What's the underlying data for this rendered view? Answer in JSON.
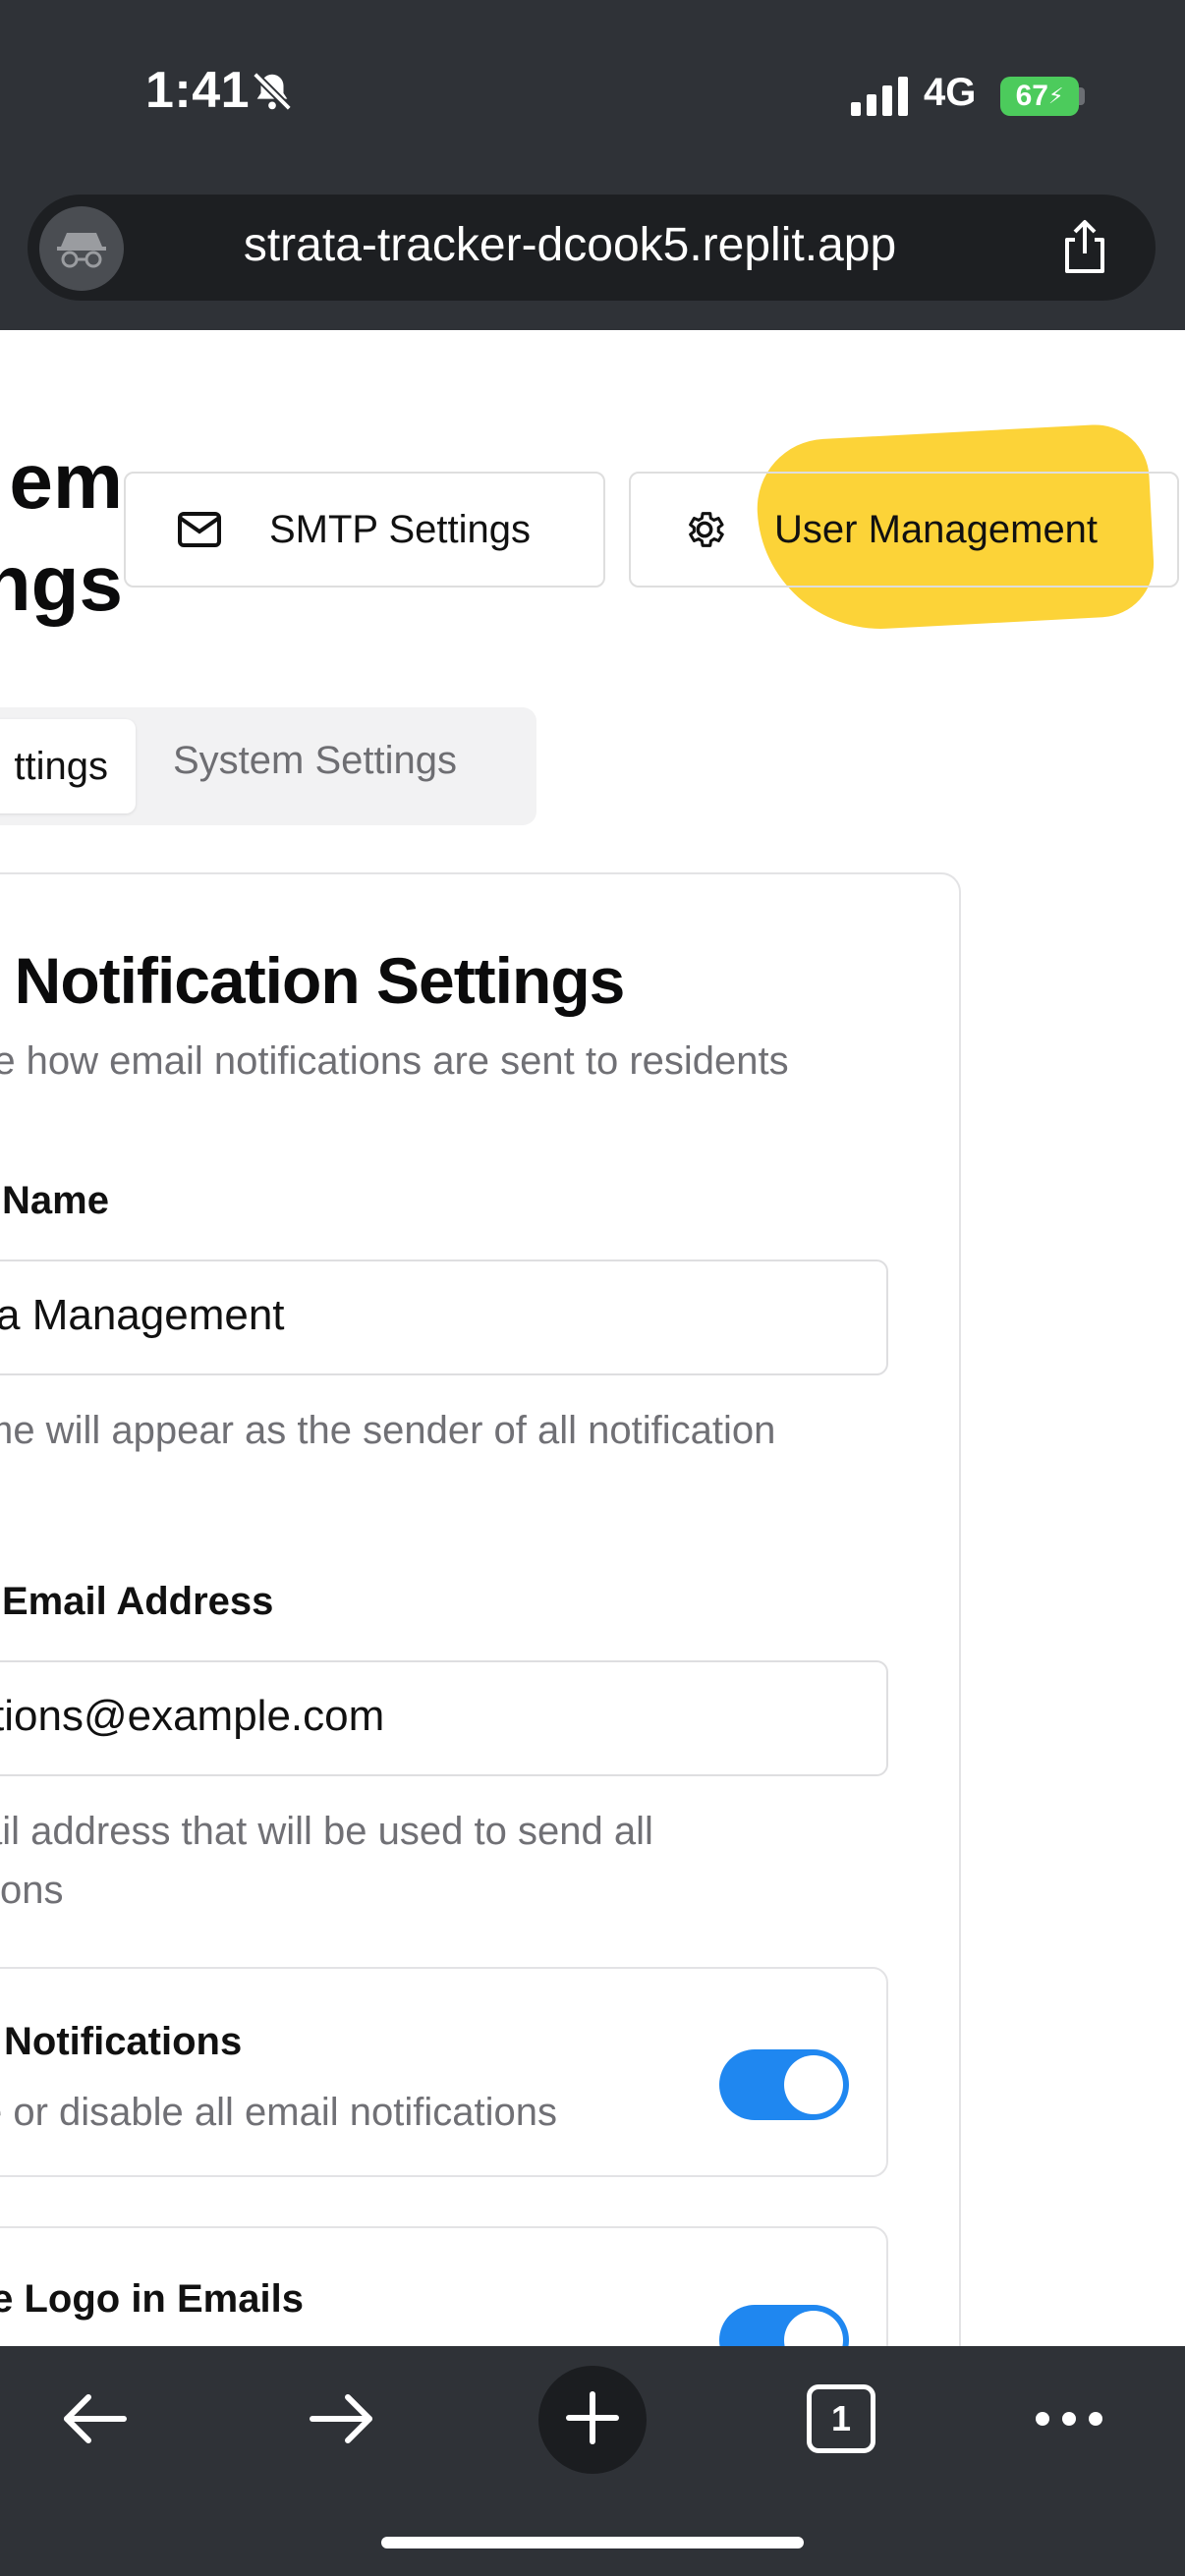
{
  "status_bar": {
    "time": "1:41",
    "network": "4G",
    "battery": "67"
  },
  "browser": {
    "url": "strata-tracker-dcook5.replit.app",
    "tab_count": "1"
  },
  "page": {
    "title_line1": "em",
    "title_line2": "ngs",
    "buttons": {
      "smtp_label": "SMTP Settings",
      "user_mgmt_label": "User Management"
    },
    "tabs": [
      {
        "label": "ttings",
        "active": true
      },
      {
        "label": "System Settings",
        "active": false
      }
    ],
    "card": {
      "title": "l Notification Settings",
      "description": "re how email notifications are sent to residents",
      "fields": {
        "name_label": "Name",
        "name_value": "a Management",
        "name_help": "me will appear as the sender of all notification",
        "email_label": "Email Address",
        "email_value": "tions@example.com",
        "email_help_line1": "ail address that will be used to send all",
        "email_help_line2": "tions"
      },
      "toggles": [
        {
          "title": "Notifications",
          "desc": "e or disable all email notifications",
          "on": true
        },
        {
          "title": "le Logo in Emails",
          "desc": "",
          "on": true
        }
      ]
    }
  },
  "colors": {
    "chrome": "#2f3237",
    "accent_toggle": "#1f87f0",
    "highlight": "#fccf27",
    "battery": "#4ccb5c"
  },
  "icons": [
    "silent-bell-icon",
    "signal-icon",
    "incognito-icon",
    "share-icon",
    "mail-icon",
    "gear-icon",
    "back-arrow-icon",
    "forward-arrow-icon",
    "plus-icon",
    "tabs-icon",
    "more-icon"
  ]
}
